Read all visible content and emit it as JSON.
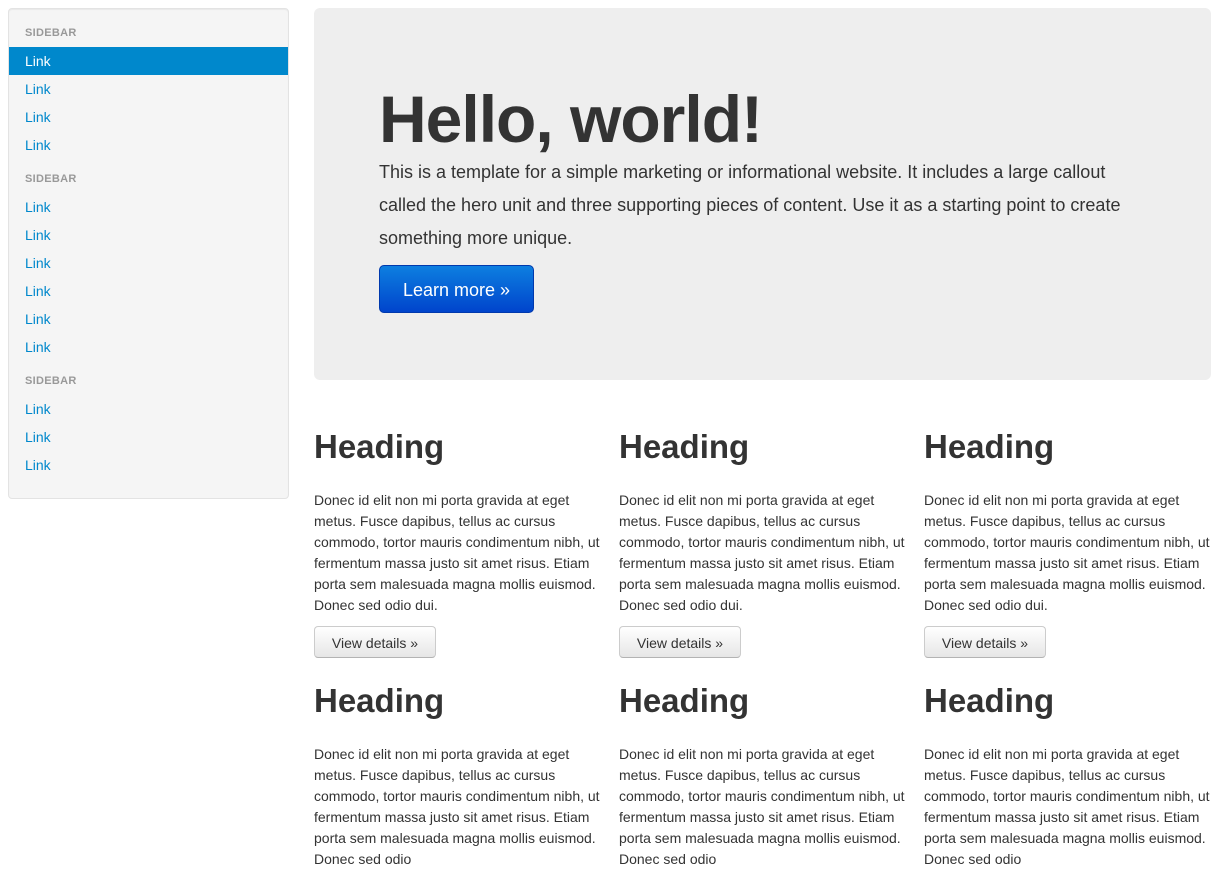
{
  "sidebar": {
    "groups": [
      {
        "header": "SIDEBAR",
        "links": [
          "Link",
          "Link",
          "Link",
          "Link"
        ]
      },
      {
        "header": "SIDEBAR",
        "links": [
          "Link",
          "Link",
          "Link",
          "Link",
          "Link",
          "Link"
        ]
      },
      {
        "header": "SIDEBAR",
        "links": [
          "Link",
          "Link",
          "Link"
        ]
      }
    ],
    "active_link": "Link"
  },
  "hero": {
    "title": "Hello, world!",
    "text": "This is a template for a simple marketing or informational website. It includes a large callout called the hero unit and three supporting pieces of content. Use it as a starting point to create something more unique.",
    "button_label": "Learn more »"
  },
  "columns": [
    {
      "heading": "Heading",
      "body": "Donec id elit non mi porta gravida at eget metus. Fusce dapibus, tellus ac cursus commodo, tortor mauris condimentum nibh, ut fermentum massa justo sit amet risus. Etiam porta sem malesuada magna mollis euismod. Donec sed odio dui.",
      "button_label": "View details »"
    },
    {
      "heading": "Heading",
      "body": "Donec id elit non mi porta gravida at eget metus. Fusce dapibus, tellus ac cursus commodo, tortor mauris condimentum nibh, ut fermentum massa justo sit amet risus. Etiam porta sem malesuada magna mollis euismod. Donec sed odio dui.",
      "button_label": "View details »"
    },
    {
      "heading": "Heading",
      "body": "Donec id elit non mi porta gravida at eget metus. Fusce dapibus, tellus ac cursus commodo, tortor mauris condimentum nibh, ut fermentum massa justo sit amet risus. Etiam porta sem malesuada magna mollis euismod. Donec sed odio dui.",
      "button_label": "View details »"
    },
    {
      "heading": "Heading",
      "body": "Donec id elit non mi porta gravida at eget metus. Fusce dapibus, tellus ac cursus commodo, tortor mauris condimentum nibh, ut fermentum massa justo sit amet risus. Etiam porta sem malesuada magna mollis euismod. Donec sed odio"
    },
    {
      "heading": "Heading",
      "body": "Donec id elit non mi porta gravida at eget metus. Fusce dapibus, tellus ac cursus commodo, tortor mauris condimentum nibh, ut fermentum massa justo sit amet risus. Etiam porta sem malesuada magna mollis euismod. Donec sed odio"
    },
    {
      "heading": "Heading",
      "body": "Donec id elit non mi porta gravida at eget metus. Fusce dapibus, tellus ac cursus commodo, tortor mauris condimentum nibh, ut fermentum massa justo sit amet risus. Etiam porta sem malesuada magna mollis euismod. Donec sed odio"
    }
  ],
  "colors": {
    "link": "#0088cc",
    "primary_button": "#0044cc",
    "hero_background": "#eeeeee",
    "sidebar_background": "#f5f5f5"
  }
}
